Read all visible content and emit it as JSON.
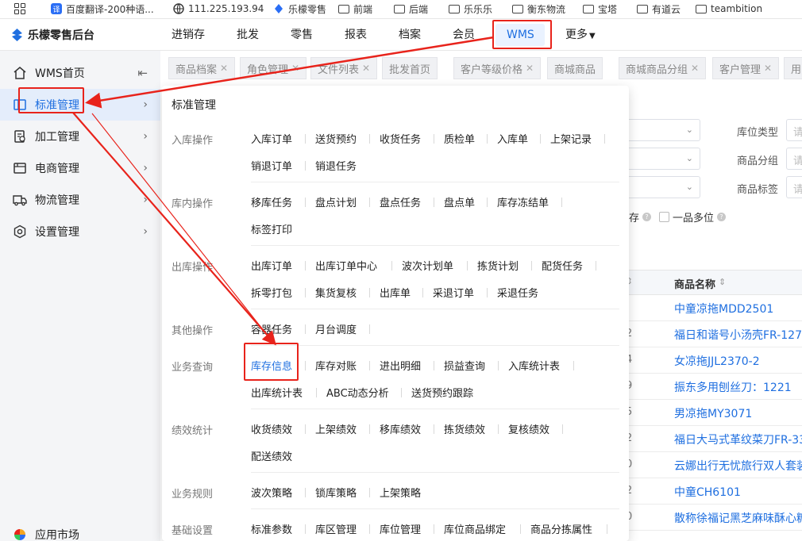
{
  "bookmarks": [
    {
      "label": "",
      "icon": "apps-grid-icon"
    },
    {
      "label": "百度翻译-200种语...",
      "icon": "baidu-translate-icon"
    },
    {
      "label": "111.225.193.94",
      "icon": "globe-icon"
    },
    {
      "label": "乐檬零售",
      "icon": "lemeng-logo-icon"
    },
    {
      "label": "前端",
      "icon": "folder-icon"
    },
    {
      "label": "后端",
      "icon": "folder-icon"
    },
    {
      "label": "乐乐乐",
      "icon": "folder-icon"
    },
    {
      "label": "衡东物流",
      "icon": "folder-icon"
    },
    {
      "label": "宝塔",
      "icon": "folder-icon"
    },
    {
      "label": "有道云",
      "icon": "folder-icon"
    },
    {
      "label": "teambition",
      "icon": "folder-icon"
    }
  ],
  "header": {
    "app_title": "乐檬零售后台",
    "nav": [
      "进销存",
      "批发",
      "零售",
      "报表",
      "档案",
      "会员",
      "WMS",
      "更多"
    ],
    "active_nav": "WMS"
  },
  "sidebar": {
    "items": [
      {
        "label": "WMS首页",
        "icon": "home-icon"
      },
      {
        "label": "标准管理",
        "icon": "standard-management-icon"
      },
      {
        "label": "加工管理",
        "icon": "processing-icon"
      },
      {
        "label": "电商管理",
        "icon": "ecommerce-icon"
      },
      {
        "label": "物流管理",
        "icon": "truck-icon"
      },
      {
        "label": "设置管理",
        "icon": "settings-icon"
      }
    ],
    "active": "标准管理",
    "footer_label": "应用市场"
  },
  "tabs": [
    "商品档案",
    "角色管理",
    "文件列表",
    "批发首页",
    "客户等级价格",
    "商城商品",
    "商城商品分组",
    "客户管理",
    "用"
  ],
  "menu": {
    "title": "标准管理",
    "groups": [
      {
        "label": "入库操作",
        "rows": [
          [
            "入库订单",
            "送货预约",
            "收货任务",
            "质检单",
            "入库单",
            "上架记录"
          ],
          [
            "销退订单",
            "销退任务"
          ]
        ]
      },
      {
        "label": "库内操作",
        "rows": [
          [
            "移库任务",
            "盘点计划",
            "盘点任务",
            "盘点单",
            "库存冻结单"
          ],
          [
            "标签打印"
          ]
        ]
      },
      {
        "label": "出库操作",
        "rows": [
          [
            "出库订单",
            "出库订单中心",
            "波次计划单",
            "拣货计划",
            "配货任务"
          ],
          [
            "拆零打包",
            "集货复核",
            "出库单",
            "采退订单",
            "采退任务"
          ]
        ]
      },
      {
        "label": "其他操作",
        "rows": [
          [
            "容器任务",
            "月台调度"
          ]
        ]
      },
      {
        "label": "业务查询",
        "rows": [
          [
            "库存信息",
            "库存对账",
            "进出明细",
            "损益查询",
            "入库统计表"
          ],
          [
            "出库统计表",
            "ABC动态分析",
            "送货预约跟踪"
          ]
        ]
      },
      {
        "label": "绩效统计",
        "rows": [
          [
            "收货绩效",
            "上架绩效",
            "移库绩效",
            "拣货绩效",
            "复核绩效"
          ],
          [
            "配送绩效"
          ]
        ]
      },
      {
        "label": "业务规则",
        "rows": [
          [
            "波次策略",
            "锁库策略",
            "上架策略"
          ]
        ]
      },
      {
        "label": "基础设置",
        "rows": [
          [
            "标准参数",
            "库区管理",
            "库位管理",
            "库位商品绑定",
            "商品分拣属性"
          ]
        ]
      }
    ],
    "highlighted_link": "库存信息"
  },
  "background_page": {
    "filters": [
      {
        "label": "库位类型",
        "placeholder": "请"
      },
      {
        "label": "商品分组",
        "placeholder": "请"
      },
      {
        "label": "商品标签",
        "placeholder": "请"
      }
    ],
    "checkbox_fragment": "存",
    "checkbox_label": "一品多位",
    "column_header": "商品名称",
    "rows": [
      {
        "num": "",
        "name": "中童凉拖MDD2501"
      },
      {
        "num": "2",
        "name": "福日和谐号小汤壳FR-127"
      },
      {
        "num": "4",
        "name": "女凉拖JJL2370-2"
      },
      {
        "num": "9",
        "name": "振东多用刨丝刀：1221"
      },
      {
        "num": "5",
        "name": "男凉拖MY3071"
      },
      {
        "num": "2",
        "name": "福日大马式革纹菜刀FR-33"
      },
      {
        "num": "0",
        "name": "云娜出行无忧旅行双人套装"
      },
      {
        "num": "2",
        "name": "中童CH6101"
      },
      {
        "num": "0",
        "name": "散称徐福记黑芝麻味酥心糖"
      }
    ]
  },
  "colors": {
    "accent": "#1f6fe0",
    "annotation": "#e8231b",
    "sidebar_bg": "#f4f5f7"
  }
}
